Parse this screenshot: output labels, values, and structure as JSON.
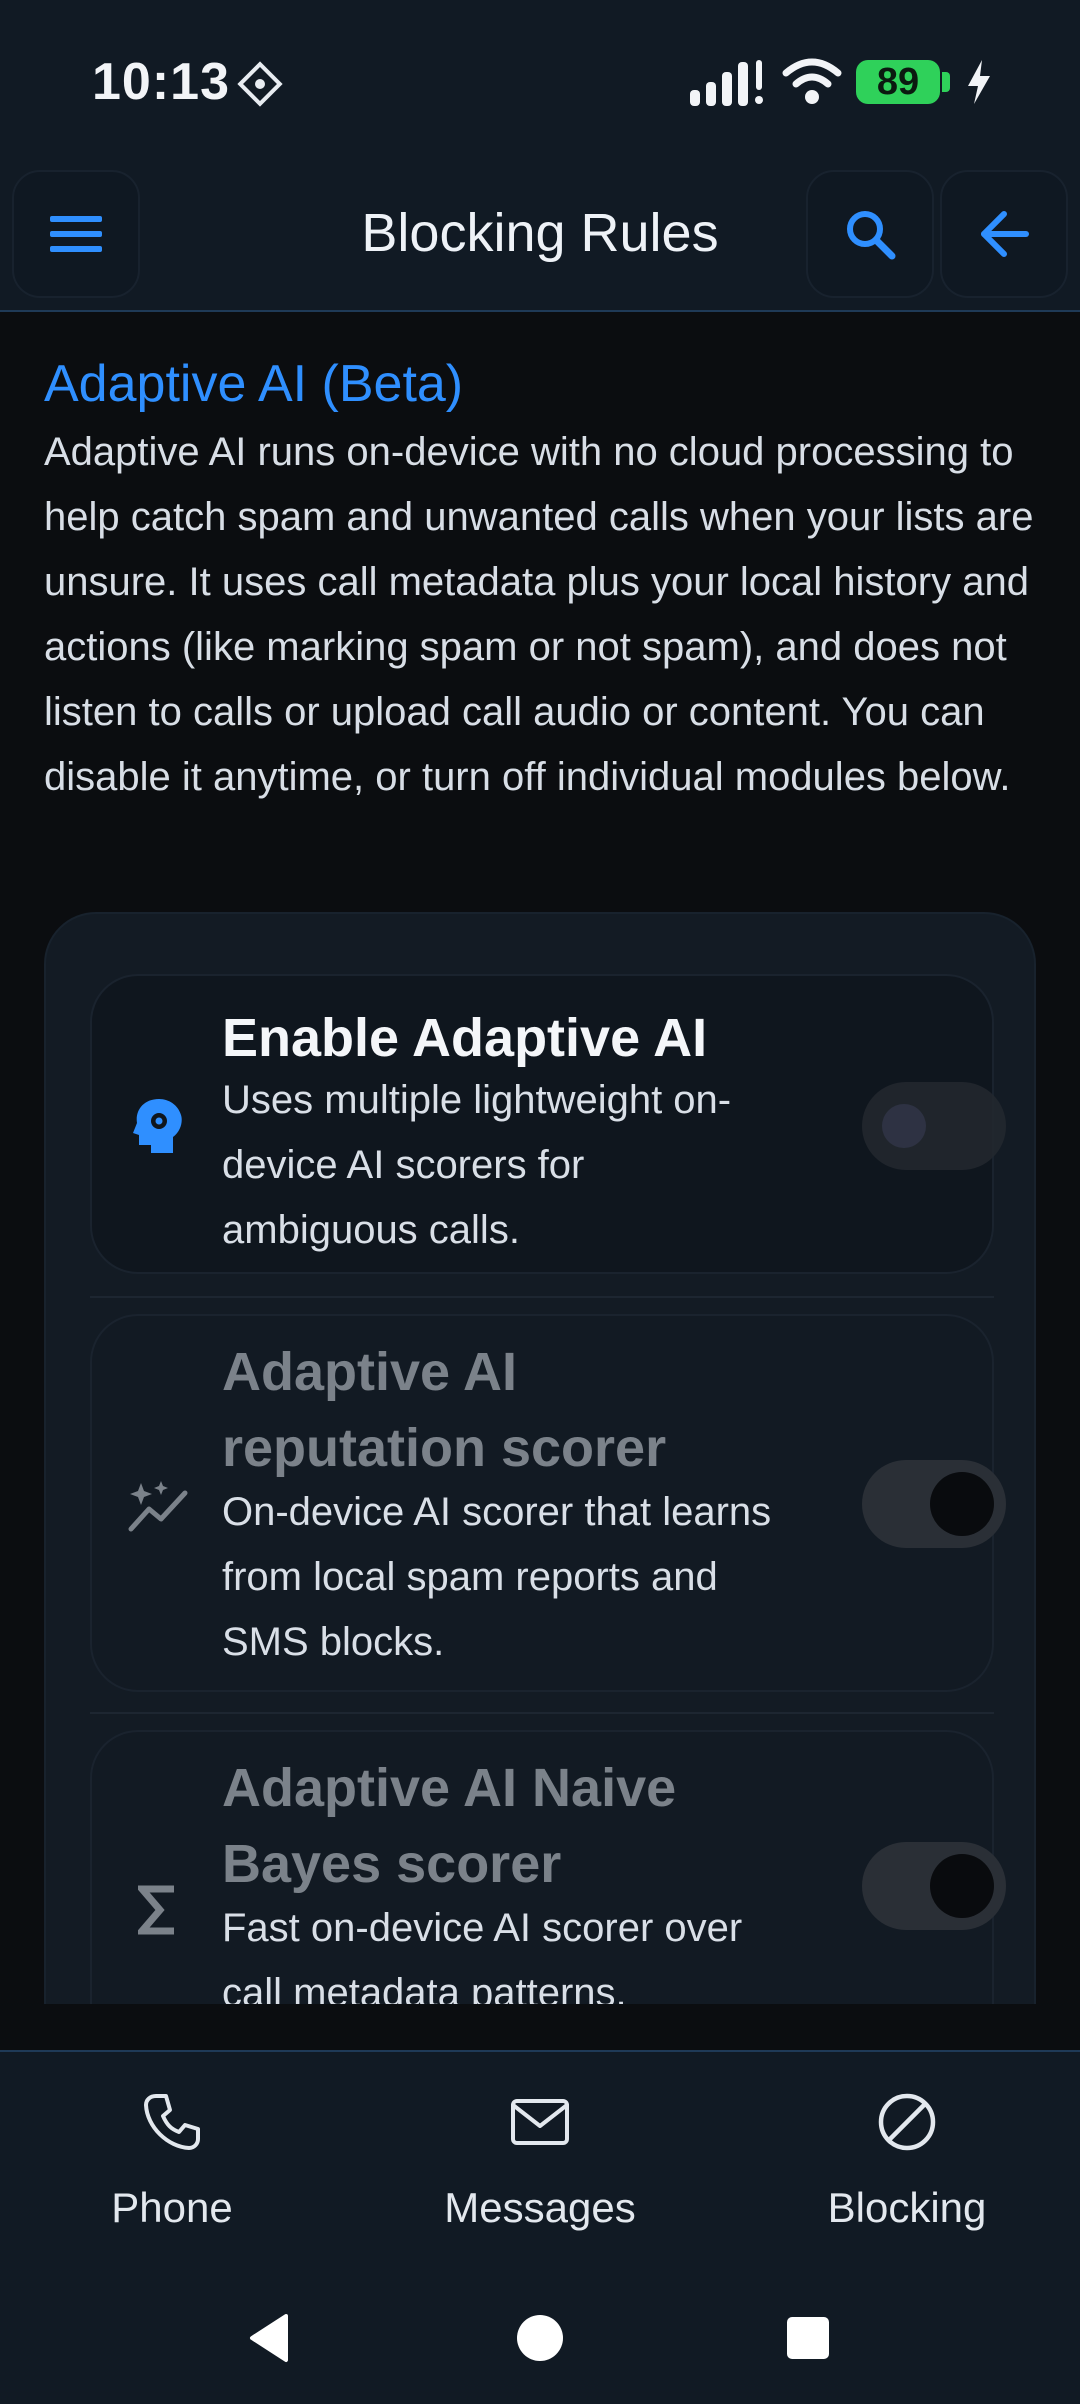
{
  "status": {
    "time": "10:13",
    "battery": "89"
  },
  "app_bar": {
    "title": "Blocking Rules",
    "menu_icon": "hamburger-menu-icon",
    "search_icon": "search-icon",
    "back_icon": "arrow-left-icon"
  },
  "section": {
    "title": "Adaptive AI (Beta)",
    "description": "Adaptive AI runs on-device with no cloud processing to help catch spam and unwanted calls when your lists are unsure. It uses call metadata plus your local history and actions (like marking spam or not spam), and does not listen to calls or upload call audio or content. You can disable it anytime, or turn off individual modules below."
  },
  "settings": [
    {
      "title": "Enable Adaptive AI",
      "subtitle": "Uses multiple lightweight on-device AI scorers for ambiguous calls.",
      "icon": "head-gear-icon",
      "enabled": false
    },
    {
      "title": "Adaptive AI reputation scorer",
      "subtitle": "On-device AI scorer that learns from local spam reports and SMS blocks.",
      "icon": "sparkle-chart-icon",
      "enabled": true
    },
    {
      "title": "Adaptive AI Naive Bayes scorer",
      "subtitle": "Fast on-device AI scorer over call metadata patterns.",
      "icon": "sigma-icon",
      "enabled": true
    }
  ],
  "bottom_nav": [
    {
      "label": "Phone",
      "icon": "phone-icon"
    },
    {
      "label": "Messages",
      "icon": "mail-icon"
    },
    {
      "label": "Blocking",
      "icon": "block-icon"
    }
  ],
  "colors": {
    "accent": "#2f8fff",
    "background": "#0b0d10",
    "bar": "#111a24"
  }
}
